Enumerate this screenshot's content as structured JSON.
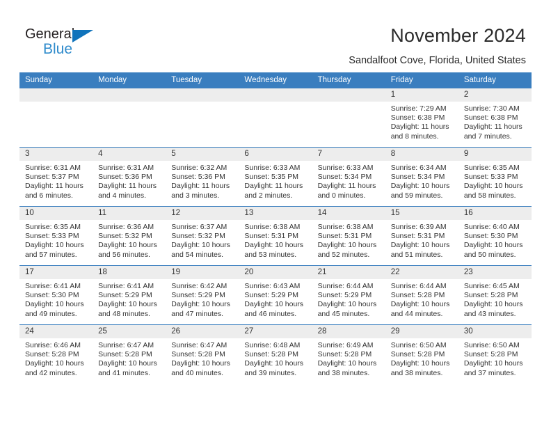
{
  "brand": {
    "name_top": "General",
    "name_bottom": "Blue",
    "triangle_color": "#1073bb",
    "blue_text_color": "#2f8bcc"
  },
  "header": {
    "title": "November 2024",
    "subtitle": "Sandalfoot Cove, Florida, United States",
    "header_bg": "#3a7ebf",
    "daynum_bg": "#ededed"
  },
  "weekday_headers": [
    "Sunday",
    "Monday",
    "Tuesday",
    "Wednesday",
    "Thursday",
    "Friday",
    "Saturday"
  ],
  "weeks": [
    {
      "days": [
        {
          "date": "",
          "blank": true,
          "sunrise": "",
          "sunset": "",
          "daylight": ""
        },
        {
          "date": "",
          "blank": true,
          "sunrise": "",
          "sunset": "",
          "daylight": ""
        },
        {
          "date": "",
          "blank": true,
          "sunrise": "",
          "sunset": "",
          "daylight": ""
        },
        {
          "date": "",
          "blank": true,
          "sunrise": "",
          "sunset": "",
          "daylight": ""
        },
        {
          "date": "",
          "blank": true,
          "sunrise": "",
          "sunset": "",
          "daylight": ""
        },
        {
          "date": "1",
          "blank": false,
          "sunrise": "Sunrise: 7:29 AM",
          "sunset": "Sunset: 6:38 PM",
          "daylight": "Daylight: 11 hours and 8 minutes."
        },
        {
          "date": "2",
          "blank": false,
          "sunrise": "Sunrise: 7:30 AM",
          "sunset": "Sunset: 6:38 PM",
          "daylight": "Daylight: 11 hours and 7 minutes."
        }
      ]
    },
    {
      "days": [
        {
          "date": "3",
          "blank": false,
          "sunrise": "Sunrise: 6:31 AM",
          "sunset": "Sunset: 5:37 PM",
          "daylight": "Daylight: 11 hours and 6 minutes."
        },
        {
          "date": "4",
          "blank": false,
          "sunrise": "Sunrise: 6:31 AM",
          "sunset": "Sunset: 5:36 PM",
          "daylight": "Daylight: 11 hours and 4 minutes."
        },
        {
          "date": "5",
          "blank": false,
          "sunrise": "Sunrise: 6:32 AM",
          "sunset": "Sunset: 5:36 PM",
          "daylight": "Daylight: 11 hours and 3 minutes."
        },
        {
          "date": "6",
          "blank": false,
          "sunrise": "Sunrise: 6:33 AM",
          "sunset": "Sunset: 5:35 PM",
          "daylight": "Daylight: 11 hours and 2 minutes."
        },
        {
          "date": "7",
          "blank": false,
          "sunrise": "Sunrise: 6:33 AM",
          "sunset": "Sunset: 5:34 PM",
          "daylight": "Daylight: 11 hours and 0 minutes."
        },
        {
          "date": "8",
          "blank": false,
          "sunrise": "Sunrise: 6:34 AM",
          "sunset": "Sunset: 5:34 PM",
          "daylight": "Daylight: 10 hours and 59 minutes."
        },
        {
          "date": "9",
          "blank": false,
          "sunrise": "Sunrise: 6:35 AM",
          "sunset": "Sunset: 5:33 PM",
          "daylight": "Daylight: 10 hours and 58 minutes."
        }
      ]
    },
    {
      "days": [
        {
          "date": "10",
          "blank": false,
          "sunrise": "Sunrise: 6:35 AM",
          "sunset": "Sunset: 5:33 PM",
          "daylight": "Daylight: 10 hours and 57 minutes."
        },
        {
          "date": "11",
          "blank": false,
          "sunrise": "Sunrise: 6:36 AM",
          "sunset": "Sunset: 5:32 PM",
          "daylight": "Daylight: 10 hours and 56 minutes."
        },
        {
          "date": "12",
          "blank": false,
          "sunrise": "Sunrise: 6:37 AM",
          "sunset": "Sunset: 5:32 PM",
          "daylight": "Daylight: 10 hours and 54 minutes."
        },
        {
          "date": "13",
          "blank": false,
          "sunrise": "Sunrise: 6:38 AM",
          "sunset": "Sunset: 5:31 PM",
          "daylight": "Daylight: 10 hours and 53 minutes."
        },
        {
          "date": "14",
          "blank": false,
          "sunrise": "Sunrise: 6:38 AM",
          "sunset": "Sunset: 5:31 PM",
          "daylight": "Daylight: 10 hours and 52 minutes."
        },
        {
          "date": "15",
          "blank": false,
          "sunrise": "Sunrise: 6:39 AM",
          "sunset": "Sunset: 5:31 PM",
          "daylight": "Daylight: 10 hours and 51 minutes."
        },
        {
          "date": "16",
          "blank": false,
          "sunrise": "Sunrise: 6:40 AM",
          "sunset": "Sunset: 5:30 PM",
          "daylight": "Daylight: 10 hours and 50 minutes."
        }
      ]
    },
    {
      "days": [
        {
          "date": "17",
          "blank": false,
          "sunrise": "Sunrise: 6:41 AM",
          "sunset": "Sunset: 5:30 PM",
          "daylight": "Daylight: 10 hours and 49 minutes."
        },
        {
          "date": "18",
          "blank": false,
          "sunrise": "Sunrise: 6:41 AM",
          "sunset": "Sunset: 5:29 PM",
          "daylight": "Daylight: 10 hours and 48 minutes."
        },
        {
          "date": "19",
          "blank": false,
          "sunrise": "Sunrise: 6:42 AM",
          "sunset": "Sunset: 5:29 PM",
          "daylight": "Daylight: 10 hours and 47 minutes."
        },
        {
          "date": "20",
          "blank": false,
          "sunrise": "Sunrise: 6:43 AM",
          "sunset": "Sunset: 5:29 PM",
          "daylight": "Daylight: 10 hours and 46 minutes."
        },
        {
          "date": "21",
          "blank": false,
          "sunrise": "Sunrise: 6:44 AM",
          "sunset": "Sunset: 5:29 PM",
          "daylight": "Daylight: 10 hours and 45 minutes."
        },
        {
          "date": "22",
          "blank": false,
          "sunrise": "Sunrise: 6:44 AM",
          "sunset": "Sunset: 5:28 PM",
          "daylight": "Daylight: 10 hours and 44 minutes."
        },
        {
          "date": "23",
          "blank": false,
          "sunrise": "Sunrise: 6:45 AM",
          "sunset": "Sunset: 5:28 PM",
          "daylight": "Daylight: 10 hours and 43 minutes."
        }
      ]
    },
    {
      "days": [
        {
          "date": "24",
          "blank": false,
          "sunrise": "Sunrise: 6:46 AM",
          "sunset": "Sunset: 5:28 PM",
          "daylight": "Daylight: 10 hours and 42 minutes."
        },
        {
          "date": "25",
          "blank": false,
          "sunrise": "Sunrise: 6:47 AM",
          "sunset": "Sunset: 5:28 PM",
          "daylight": "Daylight: 10 hours and 41 minutes."
        },
        {
          "date": "26",
          "blank": false,
          "sunrise": "Sunrise: 6:47 AM",
          "sunset": "Sunset: 5:28 PM",
          "daylight": "Daylight: 10 hours and 40 minutes."
        },
        {
          "date": "27",
          "blank": false,
          "sunrise": "Sunrise: 6:48 AM",
          "sunset": "Sunset: 5:28 PM",
          "daylight": "Daylight: 10 hours and 39 minutes."
        },
        {
          "date": "28",
          "blank": false,
          "sunrise": "Sunrise: 6:49 AM",
          "sunset": "Sunset: 5:28 PM",
          "daylight": "Daylight: 10 hours and 38 minutes."
        },
        {
          "date": "29",
          "blank": false,
          "sunrise": "Sunrise: 6:50 AM",
          "sunset": "Sunset: 5:28 PM",
          "daylight": "Daylight: 10 hours and 38 minutes."
        },
        {
          "date": "30",
          "blank": false,
          "sunrise": "Sunrise: 6:50 AM",
          "sunset": "Sunset: 5:28 PM",
          "daylight": "Daylight: 10 hours and 37 minutes."
        }
      ]
    }
  ]
}
